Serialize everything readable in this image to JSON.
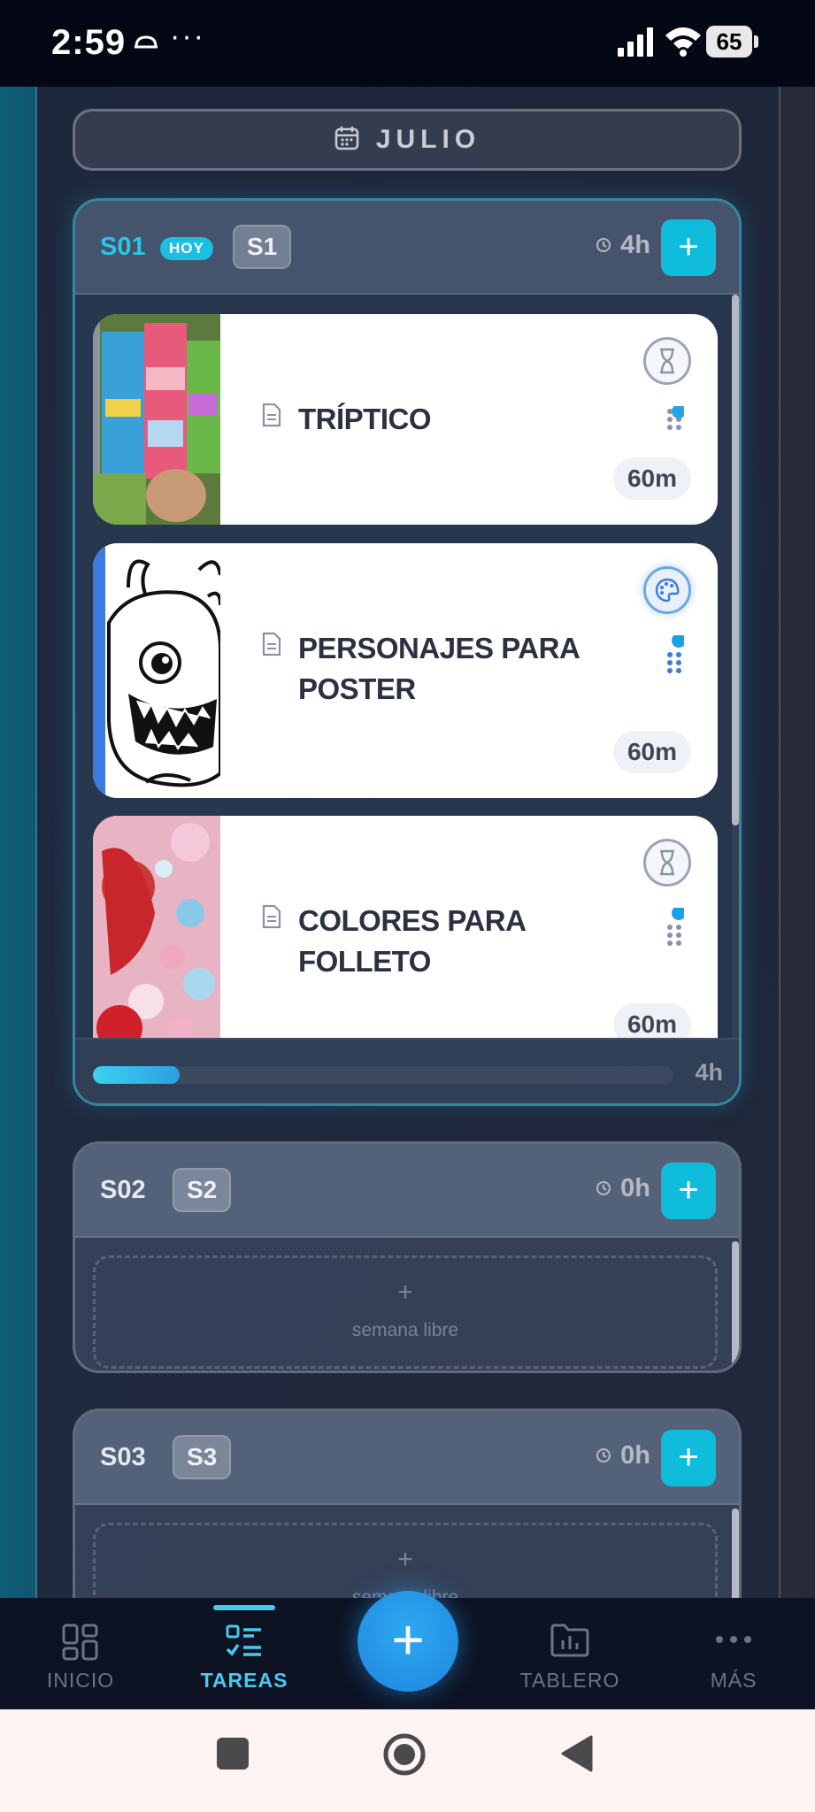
{
  "status_bar": {
    "time": "2:59",
    "more_indicator": "···",
    "battery": "65"
  },
  "month": {
    "label": "JULIO",
    "icon": "calendar-icon"
  },
  "weeks": [
    {
      "code": "S01",
      "today_badge": "HOY",
      "short": "S1",
      "hours": "4h",
      "add_label": "+",
      "progress": 0.15,
      "progress_label": "4h",
      "tasks": [
        {
          "title": "TRÍPTICO",
          "status_icon": "hourglass-icon",
          "duration": "60m",
          "thumb": "tri-fold-brochure-photo"
        },
        {
          "title": "PERSONAJES PARA POSTER",
          "status_icon": "palette-icon",
          "duration": "60m",
          "thumb": "monster-line-drawing"
        },
        {
          "title": "COLORES PARA FOLLETO",
          "status_icon": "hourglass-icon",
          "duration": "60m",
          "thumb": "colorful-bokeh-photo"
        }
      ]
    },
    {
      "code": "S02",
      "short": "S2",
      "hours": "0h",
      "add_label": "+",
      "empty_plus": "+",
      "empty_text": "semana libre"
    },
    {
      "code": "S03",
      "short": "S3",
      "hours": "0h",
      "add_label": "+",
      "empty_plus": "+",
      "empty_text": "semana libre"
    }
  ],
  "nav": {
    "items": [
      {
        "label": "INICIO",
        "icon": "grid-icon"
      },
      {
        "label": "TAREAS",
        "icon": "checklist-icon"
      },
      {
        "label": "TABLERO",
        "icon": "folder-chart-icon"
      },
      {
        "label": "MÁS",
        "icon": "more-icon"
      }
    ],
    "fab_label": "+"
  },
  "colors": {
    "accent": "#10bcdc",
    "today": "#28c6e8",
    "fab": "#1e86e0",
    "task_accent": "#3b7be0"
  }
}
